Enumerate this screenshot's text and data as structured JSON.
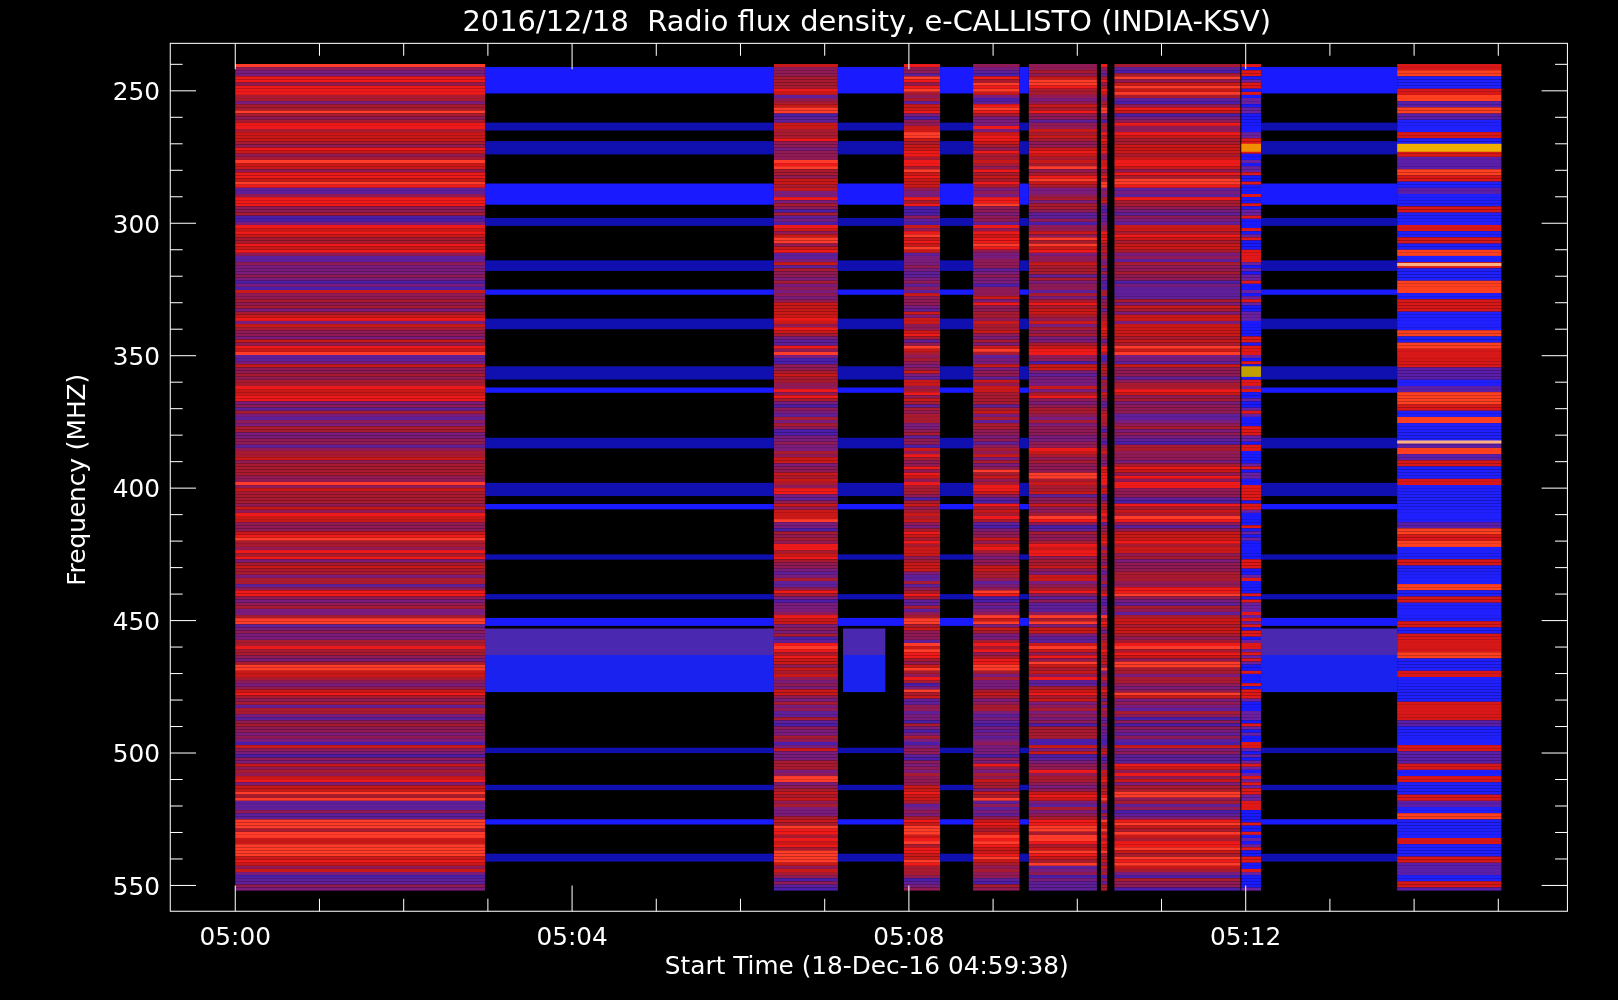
{
  "title": "2016/12/18  Radio flux density, e-CALLISTO (INDIA-KSV)",
  "y_axis": {
    "label": "Frequency (MHZ)",
    "ticks": [
      "250",
      "300",
      "350",
      "400",
      "450",
      "500",
      "550"
    ]
  },
  "x_axis": {
    "label": "Start Time (18-Dec-16 04:59:38)",
    "ticks": [
      "05:00",
      "05:04",
      "05:08",
      "05:12"
    ]
  }
}
